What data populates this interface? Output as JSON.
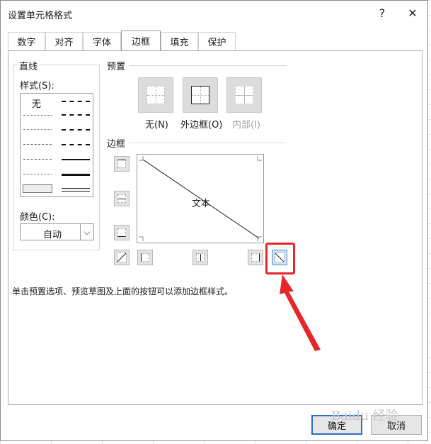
{
  "window": {
    "title": "设置单元格格式",
    "help_glyph": "?",
    "close_glyph": "✕"
  },
  "tabs": [
    {
      "label": "数字",
      "active": false
    },
    {
      "label": "对齐",
      "active": false
    },
    {
      "label": "字体",
      "active": false
    },
    {
      "label": "边框",
      "active": true
    },
    {
      "label": "填充",
      "active": false
    },
    {
      "label": "保护",
      "active": false
    }
  ],
  "line": {
    "group_label": "直线",
    "style_label": "样式(S):",
    "none_label": "无",
    "color_label": "颜色(C):",
    "color_value": "自动",
    "color_arrow": "⌵"
  },
  "presets": {
    "group_label": "预置",
    "items": [
      {
        "label": "无(N)",
        "icon": "no-border-icon",
        "enabled": true
      },
      {
        "label": "外边框(O)",
        "icon": "outline-border-icon",
        "enabled": true
      },
      {
        "label": "内部(I)",
        "icon": "inside-border-icon",
        "enabled": false
      }
    ]
  },
  "border": {
    "group_label": "边框",
    "preview_text": "文本"
  },
  "hint": "单击预置选项、预览草图及上面的按钮可以添加边框样式。",
  "buttons": {
    "ok": "确定",
    "cancel": "取消"
  },
  "watermark": "Baidu 经验",
  "colors": {
    "highlight": "#e5262a",
    "primary_border": "#2b6cc4"
  }
}
